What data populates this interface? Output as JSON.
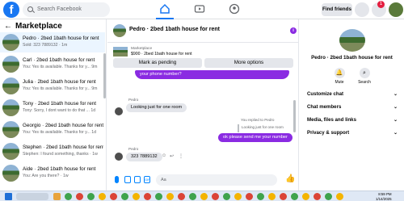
{
  "topbar": {
    "logo_letter": "f",
    "search_placeholder": "Search Facebook",
    "find_friends": "Find friends",
    "notif_count": "1",
    "brand_color": "#1877f2"
  },
  "sidebar": {
    "title": "Marketplace",
    "back_icon": "←",
    "chats": [
      {
        "name": "Pedro · 2bed 1bath house for rent",
        "preview": "Sold: 323 7889132 · 1m",
        "active": true
      },
      {
        "name": "Carl · 2bed 1bath house for rent",
        "preview": "You: Yes its available. Thanks for y... 9m",
        "active": false
      },
      {
        "name": "Julia · 2bed 1bath house for rent",
        "preview": "You: Yes its available. Thanks for y... 9m",
        "active": false
      },
      {
        "name": "Tony · 2bed 1bath house for rent",
        "preview": "Tony: Sorry, I dont want to do that ... 1d",
        "active": false
      },
      {
        "name": "Georgio · 2bed 1bath house for rent",
        "preview": "You: Yes its available. Thanks for y... 1d",
        "active": false
      },
      {
        "name": "Stephen · 2bed 1bath house for rent",
        "preview": "Stephen: I found something, thanks · 1w",
        "active": false
      },
      {
        "name": "Aide · 2bed 1bath house for rent",
        "preview": "You: Are you there? · 1w",
        "active": false
      }
    ]
  },
  "conversation": {
    "title": "Pedro · 2bed 1bath house for rent",
    "info_icon": "i",
    "listing_label": "Marketplace",
    "listing_price": "$900 · 2bed 1bath house for rent",
    "mark_pending": "Mark as pending",
    "more_options": "More options",
    "messages": {
      "out_top": "your phone number?",
      "in_sender_1": "Pedro",
      "in_1": "Looking just for one room",
      "reply_note": "You replied to Pedro",
      "reply_quote": "Looking just for one room",
      "out_reply": "ok please send me your number",
      "in_sender_2": "Pedro",
      "in_2": "323 7889132"
    },
    "composer_placeholder": "Aa",
    "like_icon": "👍"
  },
  "details": {
    "title": "Pedro · 2bed 1bath house for rent",
    "mute_label": "Mute",
    "search_label": "Search",
    "rows": [
      "Customize chat",
      "Chat members",
      "Media, files and links",
      "Privacy & support"
    ]
  },
  "taskbar": {
    "time": "8:59 PM",
    "date": "1/14/2025"
  }
}
